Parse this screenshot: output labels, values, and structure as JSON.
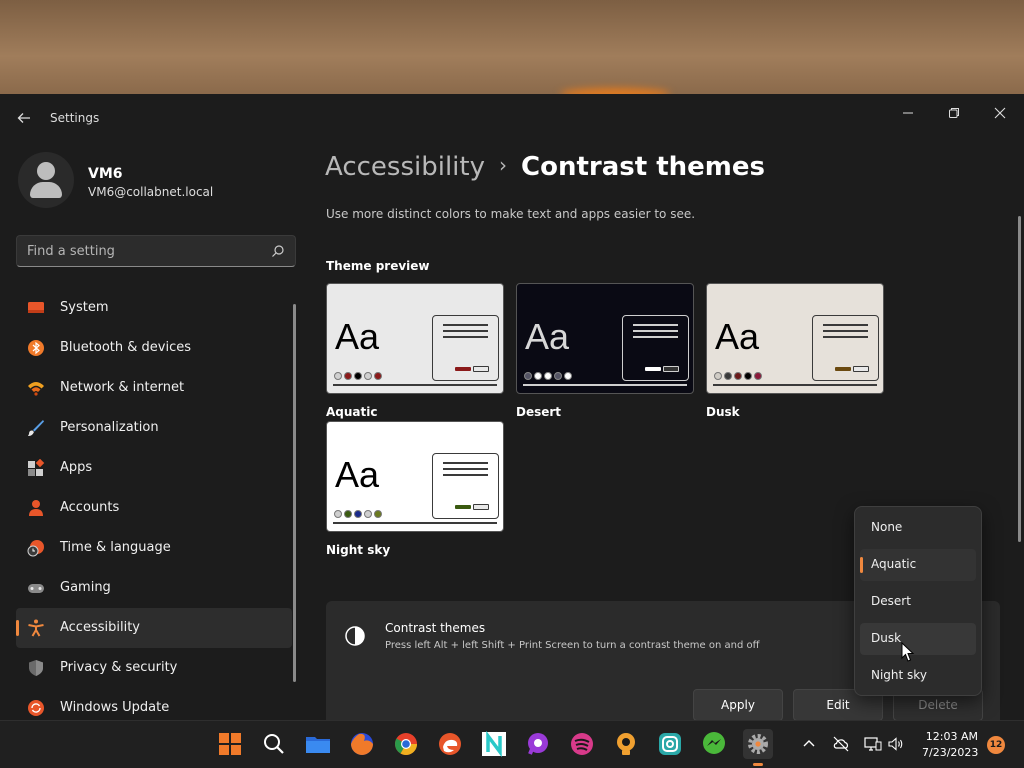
{
  "window": {
    "title": "Settings"
  },
  "user": {
    "name": "VM6",
    "email": "VM6@collabnet.local"
  },
  "search": {
    "placeholder": "Find a setting"
  },
  "sidebar": {
    "items": [
      {
        "label": "System",
        "icon": "system-icon"
      },
      {
        "label": "Bluetooth & devices",
        "icon": "bluetooth-icon"
      },
      {
        "label": "Network & internet",
        "icon": "wifi-icon"
      },
      {
        "label": "Personalization",
        "icon": "brush-icon"
      },
      {
        "label": "Apps",
        "icon": "apps-icon"
      },
      {
        "label": "Accounts",
        "icon": "accounts-icon"
      },
      {
        "label": "Time & language",
        "icon": "clock-globe-icon"
      },
      {
        "label": "Gaming",
        "icon": "gamepad-icon"
      },
      {
        "label": "Accessibility",
        "icon": "accessibility-icon",
        "active": true
      },
      {
        "label": "Privacy & security",
        "icon": "shield-icon"
      },
      {
        "label": "Windows Update",
        "icon": "update-icon"
      }
    ]
  },
  "page": {
    "breadcrumb_parent": "Accessibility",
    "breadcrumb_separator": "›",
    "title": "Contrast themes",
    "subtitle": "Use more distinct colors to make text and apps easier to see.",
    "preview_heading": "Theme preview"
  },
  "themes": [
    {
      "name": "Aquatic",
      "sample": "Aa",
      "bg": "#e9e9e9",
      "fg": "#000000",
      "accent": "#8b1a1a",
      "dots": [
        "#d0d0d0",
        "#8b1a1a",
        "#000000",
        "#d0d0d0",
        "#8b1a1a"
      ]
    },
    {
      "name": "Desert",
      "sample": "Aa",
      "bg": "#0a0a14",
      "fg": "#d8d8d8",
      "accent": "#ffffff",
      "dots": [
        "#555566",
        "#ffffff",
        "#ffffff",
        "#555566",
        "#ffffff"
      ]
    },
    {
      "name": "Dusk",
      "sample": "Aa",
      "bg": "#e6e1da",
      "fg": "#000000",
      "accent": "#6b4a10",
      "dots": [
        "#d0ccc5",
        "#3a3a3a",
        "#6b1a1a",
        "#000000",
        "#8b1a3a"
      ]
    },
    {
      "name": "Night sky",
      "sample": "Aa",
      "bg": "#ffffff",
      "fg": "#000000",
      "accent": "#3a5a10",
      "dots": [
        "#cfcfcf",
        "#3a5a10",
        "#1a2a8b",
        "#cfcfcf",
        "#6b7a20"
      ]
    }
  ],
  "setting": {
    "title": "Contrast themes",
    "description": "Press left Alt + left Shift + Print Screen to turn a contrast theme on and off",
    "icon": "contrast-icon"
  },
  "buttons": {
    "apply": "Apply",
    "edit": "Edit",
    "delete": "Delete"
  },
  "dropdown": {
    "options": [
      "None",
      "Aquatic",
      "Desert",
      "Dusk",
      "Night sky"
    ],
    "selected": "Aquatic",
    "hovered": "Dusk"
  },
  "taskbar": {
    "apps": [
      "start-icon",
      "search-icon",
      "file-explorer-icon",
      "firefox-icon",
      "chrome-icon",
      "edge-icon",
      "notion-icon",
      "whatsapp-icon",
      "spotify-icon",
      "lightbulb-icon",
      "instagram-icon",
      "messenger-icon",
      "settings-icon"
    ],
    "time": "12:03 AM",
    "date": "7/23/2023",
    "notifications": "12"
  },
  "colors": {
    "accent": "#f0883e",
    "window_bg": "#1c1c1c",
    "card_bg": "#2b2b2b"
  }
}
